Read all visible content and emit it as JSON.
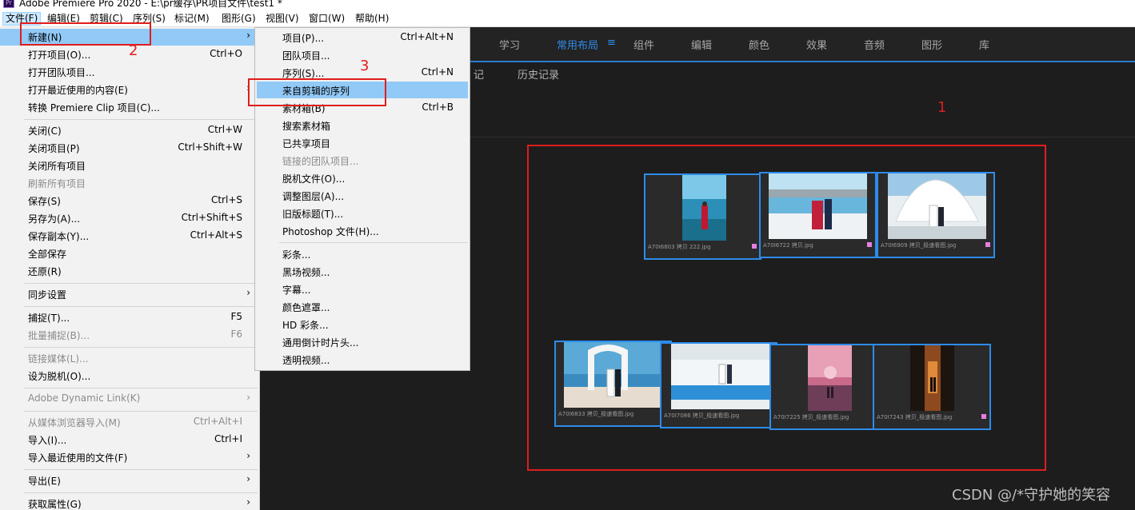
{
  "window": {
    "title": "Adobe Premiere Pro 2020 - E:\\pr缓存\\PR项目文件\\test1 *"
  },
  "menubar": [
    {
      "label": "文件(F)"
    },
    {
      "label": "编辑(E)"
    },
    {
      "label": "剪辑(C)"
    },
    {
      "label": "序列(S)"
    },
    {
      "label": "标记(M)"
    },
    {
      "label": "图形(G)"
    },
    {
      "label": "视图(V)"
    },
    {
      "label": "窗口(W)"
    },
    {
      "label": "帮助(H)"
    }
  ],
  "workspace_tabs": [
    {
      "label": "学习"
    },
    {
      "label": "常用布局"
    },
    {
      "label": "组件"
    },
    {
      "label": "编辑"
    },
    {
      "label": "颜色"
    },
    {
      "label": "效果"
    },
    {
      "label": "音频"
    },
    {
      "label": "图形"
    },
    {
      "label": "库"
    }
  ],
  "workspace_menu_glyph": "≡",
  "workspace_more_glyph": "»",
  "panel_tabs": [
    {
      "label": "记"
    },
    {
      "label": "历史记录"
    }
  ],
  "file_menu": [
    {
      "label": "新建(N)",
      "shortcut": "",
      "arrow": "›"
    },
    {
      "label": "打开项目(O)...",
      "shortcut": "Ctrl+O"
    },
    {
      "label": "打开团队项目...",
      "shortcut": ""
    },
    {
      "label": "打开最近使用的内容(E)",
      "shortcut": "",
      "arrow": "›"
    },
    {
      "label": "转换 Premiere Clip 项目(C)...",
      "shortcut": ""
    },
    {
      "label": "关闭(C)",
      "shortcut": "Ctrl+W"
    },
    {
      "label": "关闭项目(P)",
      "shortcut": "Ctrl+Shift+W"
    },
    {
      "label": "关闭所有项目",
      "shortcut": ""
    },
    {
      "label": "刷新所有项目",
      "shortcut": ""
    },
    {
      "label": "保存(S)",
      "shortcut": "Ctrl+S"
    },
    {
      "label": "另存为(A)...",
      "shortcut": "Ctrl+Shift+S"
    },
    {
      "label": "保存副本(Y)...",
      "shortcut": "Ctrl+Alt+S"
    },
    {
      "label": "全部保存",
      "shortcut": ""
    },
    {
      "label": "还原(R)",
      "shortcut": ""
    },
    {
      "label": "同步设置",
      "shortcut": "",
      "arrow": "›"
    },
    {
      "label": "捕捉(T)...",
      "shortcut": "F5"
    },
    {
      "label": "批量捕捉(B)...",
      "shortcut": "F6"
    },
    {
      "label": "链接媒体(L)...",
      "shortcut": ""
    },
    {
      "label": "设为脱机(O)...",
      "shortcut": ""
    },
    {
      "label": "Adobe Dynamic Link(K)",
      "shortcut": "",
      "arrow": "›"
    },
    {
      "label": "从媒体浏览器导入(M)",
      "shortcut": "Ctrl+Alt+I"
    },
    {
      "label": "导入(I)...",
      "shortcut": "Ctrl+I"
    },
    {
      "label": "导入最近使用的文件(F)",
      "shortcut": "",
      "arrow": "›"
    },
    {
      "label": "导出(E)",
      "shortcut": "",
      "arrow": "›"
    },
    {
      "label": "获取属性(G)",
      "shortcut": "",
      "arrow": "›"
    }
  ],
  "new_submenu": [
    {
      "label": "项目(P)...",
      "shortcut": "Ctrl+Alt+N"
    },
    {
      "label": "团队项目...",
      "shortcut": ""
    },
    {
      "label": "序列(S)...",
      "shortcut": "Ctrl+N"
    },
    {
      "label": "来自剪辑的序列",
      "shortcut": ""
    },
    {
      "label": "素材箱(B)",
      "shortcut": "Ctrl+B"
    },
    {
      "label": "搜索素材箱",
      "shortcut": ""
    },
    {
      "label": "已共享项目",
      "shortcut": ""
    },
    {
      "label": "链接的团队项目...",
      "shortcut": ""
    },
    {
      "label": "脱机文件(O)...",
      "shortcut": ""
    },
    {
      "label": "调整图层(A)...",
      "shortcut": ""
    },
    {
      "label": "旧版标题(T)...",
      "shortcut": ""
    },
    {
      "label": "Photoshop 文件(H)...",
      "shortcut": ""
    },
    {
      "label": "彩条...",
      "shortcut": ""
    },
    {
      "label": "黑场视频...",
      "shortcut": ""
    },
    {
      "label": "字幕...",
      "shortcut": ""
    },
    {
      "label": "颜色遮罩...",
      "shortcut": ""
    },
    {
      "label": "HD 彩条...",
      "shortcut": ""
    },
    {
      "label": "通用倒计时片头...",
      "shortcut": ""
    },
    {
      "label": "透明视频...",
      "shortcut": ""
    }
  ],
  "clips": [
    {
      "caption": "A70I6803 拷贝 222.jpg"
    },
    {
      "caption": "A70I6722 拷贝.jpg"
    },
    {
      "caption": "A70I6909 拷贝_极速看图.jpg"
    },
    {
      "caption": "A70I6833 拷贝_极速看图.jpg"
    },
    {
      "caption": "A70I7086 拷贝_极速看图.jpg"
    },
    {
      "caption": "A70I7225 拷贝_极速看图.jpg"
    },
    {
      "caption": "A70I7243 拷贝_极速看图.jpg"
    }
  ],
  "annotations": {
    "one": "1",
    "two": "2",
    "three": "3"
  },
  "watermark": "CSDN @/*守护她的笑容",
  "colors": {
    "accent": "#2d8ceb",
    "highlight": "#91c9f7",
    "annotation": "#e01d1d"
  }
}
